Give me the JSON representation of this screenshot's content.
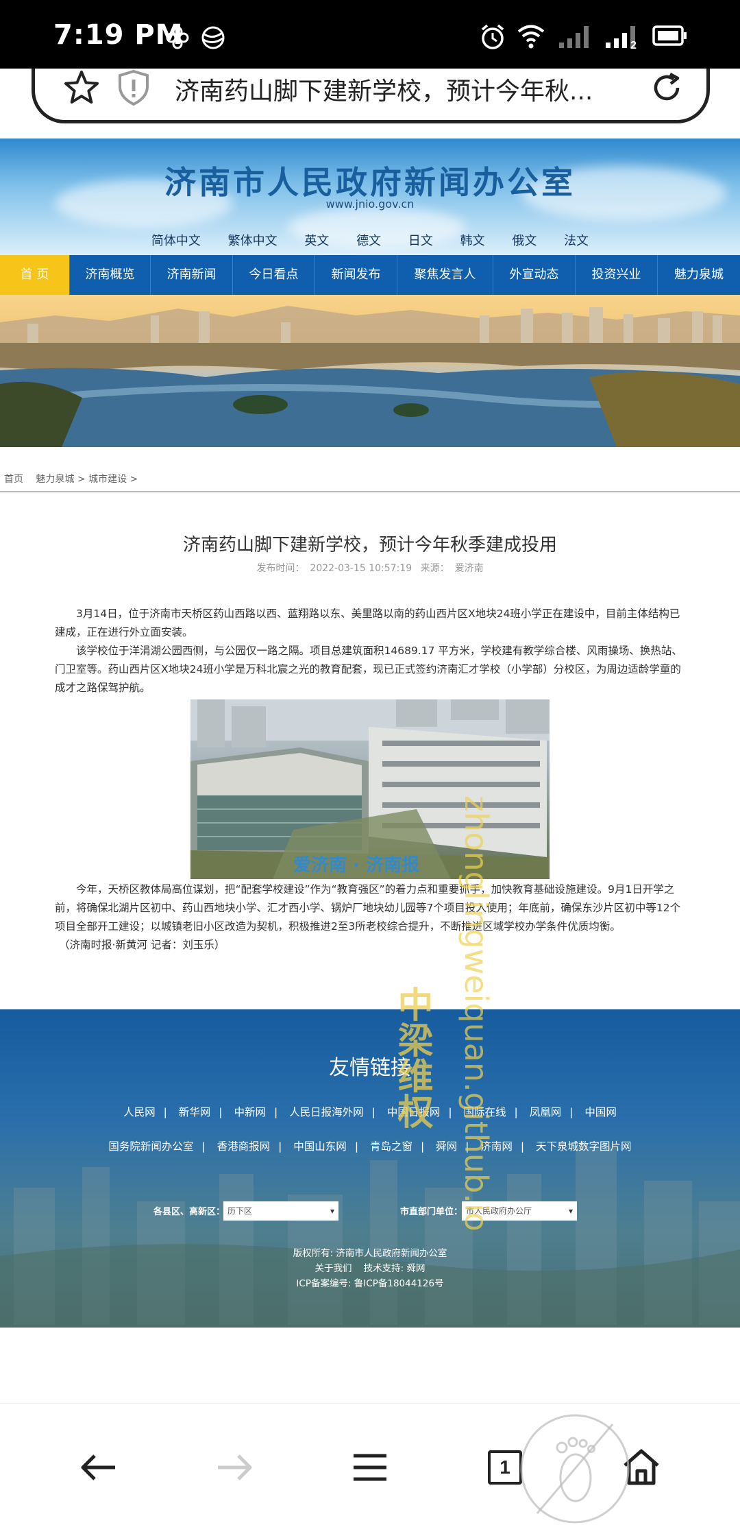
{
  "status": {
    "time": "7:19 PM",
    "signal_badge": "2"
  },
  "browser": {
    "page_title": "济南药山脚下建新学校，预计今年秋...",
    "tab_count": "1"
  },
  "site": {
    "title": "济南市人民政府新闻办公室",
    "url": "www.jnio.gov.cn",
    "languages": [
      "简体中文",
      "繁体中文",
      "英文",
      "德文",
      "日文",
      "韩文",
      "俄文",
      "法文"
    ],
    "nav": [
      "首  页",
      "济南概览",
      "济南新闻",
      "今日看点",
      "新闻发布",
      "聚焦发言人",
      "外宣动态",
      "投资兴业",
      "魅力泉城"
    ]
  },
  "breadcrumb": [
    "首页",
    "魅力泉城 > 城市建设 >"
  ],
  "article": {
    "title": "济南药山脚下建新学校，预计今年秋季建成投用",
    "meta": {
      "time_label": "发布时间：",
      "time": "2022-03-15 10:57:19",
      "source_label": "来源：",
      "source": "爱济南"
    },
    "paragraphs": [
      "3月14日，位于济南市天桥区药山西路以西、蓝翔路以东、美里路以南的药山西片区X地块24班小学正在建设中，目前主体结构已建成，正在进行外立面安装。",
      "该学校位于洋涓湖公园西侧，与公园仅一路之隔。项目总建筑面积14689.17 平方米，学校建有教学综合楼、风雨操场、换热站、门卫室等。药山西片区X地块24班小学是万科北宸之光的教育配套，现已正式签约济南汇才学校（小学部）分校区，为周边适龄学童的成才之路保驾护航。",
      "今年，天桥区教体局高位谋划，把“配套学校建设”作为“教育强区”的着力点和重要抓手，加快教育基础设施建设。9月1日开学之前，将确保北湖片区初中、药山西地块小学、汇才西小学、锅炉厂地块幼儿园等7个项目投入使用；年底前，确保东沙片区初中等12个项目全部开工建设；以城镇老旧小区改造为契机，积极推进2至3所老校综合提升，不断推进区域学校办学条件优质均衡。",
      "（济南时报·新黄河 记者：刘玉乐）"
    ],
    "photo_watermark": "爱济南 · 济南报"
  },
  "footer": {
    "title": "友情链接",
    "links_row1": [
      "人民网",
      "新华网",
      "中新网",
      "人民日报海外网",
      "中国日报网",
      "国际在线",
      "凤凰网",
      "中国网"
    ],
    "links_row2": [
      "国务院新闻办公室",
      "香港商报网",
      "中国山东网",
      "青岛之窗",
      "舜网",
      "济南网",
      "天下泉城数字图片网"
    ],
    "select1_label": "各县区、高新区：",
    "select1_value": "历下区",
    "select2_label": "市直部门单位：",
    "select2_value": "市人民政府办公厅",
    "copyright": "版权所有: 济南市人民政府新闻办公室",
    "about": "关于我们",
    "tech": "技术支持: 舜网",
    "icp": "ICP备案编号: 鲁ICP备18044126号"
  },
  "watermark": {
    "cn": "中梁维权",
    "url": "zhonglingweiquan.github.io"
  }
}
